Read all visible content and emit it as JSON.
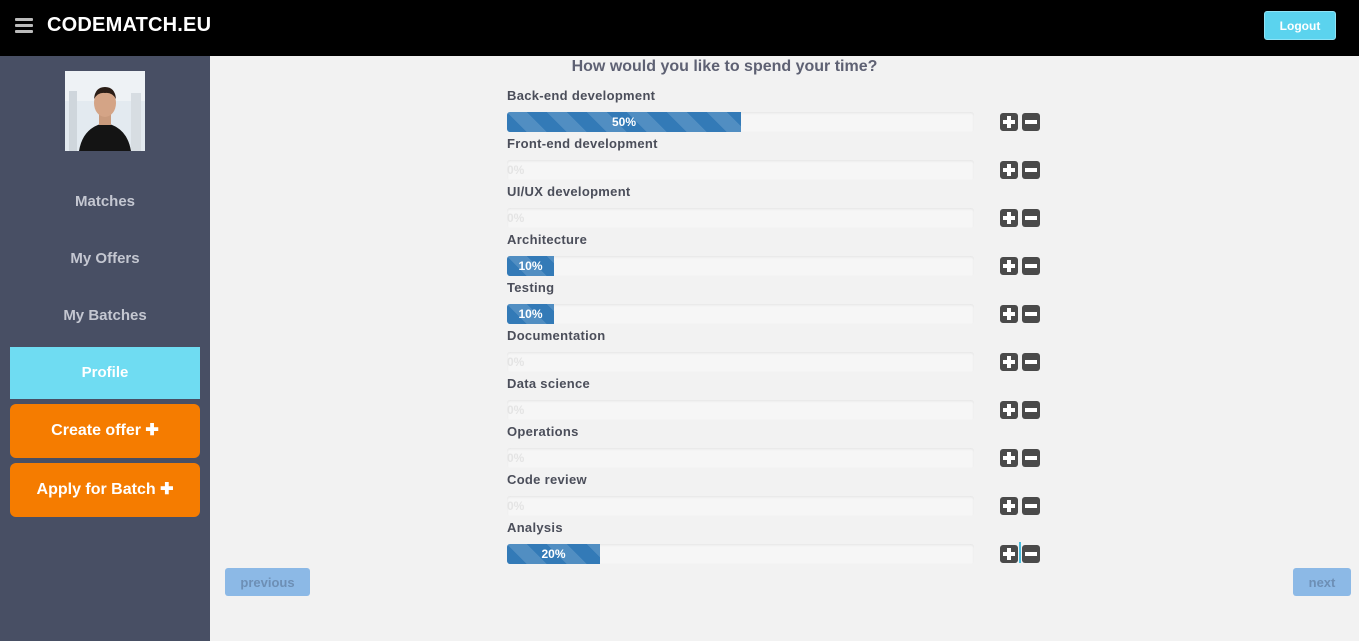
{
  "header": {
    "brand": "CODEMATCH.EU",
    "logout_label": "Logout"
  },
  "sidebar": {
    "avatar_alt": "user avatar",
    "nav": [
      {
        "label": "Matches"
      },
      {
        "label": "My Offers"
      },
      {
        "label": "My Batches"
      },
      {
        "label": "Profile",
        "active": true
      }
    ],
    "create_offer_label": "Create offer ✚",
    "apply_batch_label": "Apply for Batch ✚"
  },
  "main": {
    "question": "How would you like to spend your time?",
    "categories": [
      {
        "label": "Back-end development",
        "percent": 50,
        "text": "50%"
      },
      {
        "label": "Front-end development",
        "percent": 0,
        "text": "0%"
      },
      {
        "label": "UI/UX development",
        "percent": 0,
        "text": "0%"
      },
      {
        "label": "Architecture",
        "percent": 10,
        "text": "10%"
      },
      {
        "label": "Testing",
        "percent": 10,
        "text": "10%"
      },
      {
        "label": "Documentation",
        "percent": 0,
        "text": "0%"
      },
      {
        "label": "Data science",
        "percent": 0,
        "text": "0%"
      },
      {
        "label": "Operations",
        "percent": 0,
        "text": "0%"
      },
      {
        "label": "Code review",
        "percent": 0,
        "text": "0%"
      },
      {
        "label": "Analysis",
        "percent": 20,
        "text": "20%"
      }
    ],
    "previous_label": "previous",
    "next_label": "next"
  },
  "colors": {
    "accent": "#6fdcf2",
    "orange": "#f57c00",
    "bar": "#337ab7",
    "sidebar": "#484f64"
  }
}
